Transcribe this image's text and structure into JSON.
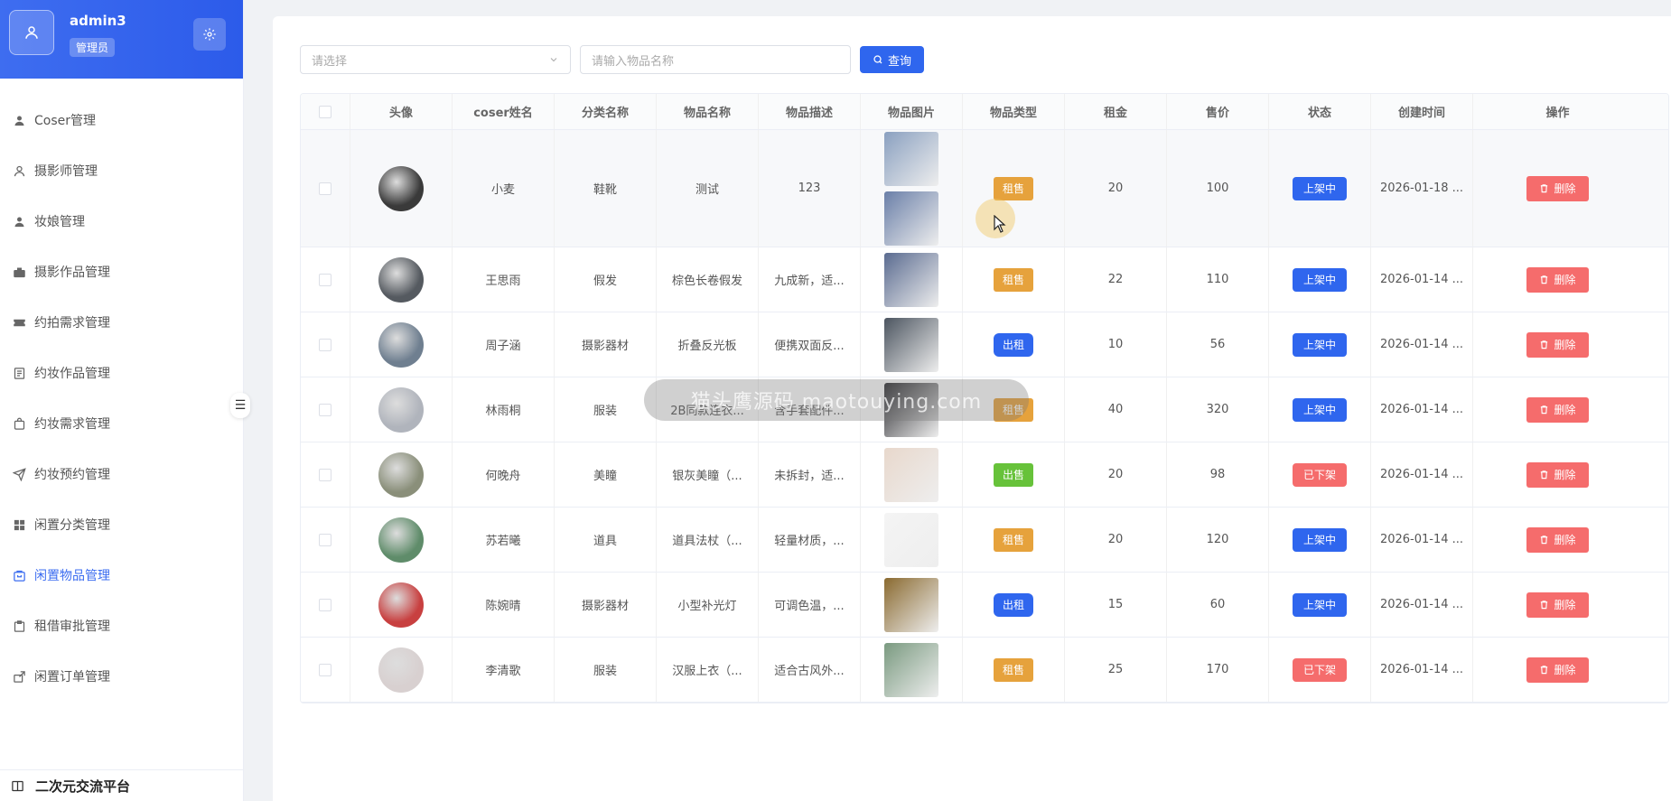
{
  "user": {
    "name": "admin3",
    "role": "管理员"
  },
  "menu": [
    {
      "label": "Coser管理",
      "icon": "user-icon",
      "active": false
    },
    {
      "label": "摄影师管理",
      "icon": "user-outline-icon",
      "active": false
    },
    {
      "label": "妆娘管理",
      "icon": "user-icon",
      "active": false
    },
    {
      "label": "摄影作品管理",
      "icon": "camera-icon",
      "active": false
    },
    {
      "label": "约拍需求管理",
      "icon": "ticket-icon",
      "active": false
    },
    {
      "label": "约妆作品管理",
      "icon": "document-icon",
      "active": false
    },
    {
      "label": "约妆需求管理",
      "icon": "bag-icon",
      "active": false
    },
    {
      "label": "约妆预约管理",
      "icon": "send-icon",
      "active": false
    },
    {
      "label": "闲置分类管理",
      "icon": "grid-icon",
      "active": false
    },
    {
      "label": "闲置物品管理",
      "icon": "box-icon",
      "active": true
    },
    {
      "label": "租借审批管理",
      "icon": "clipboard-icon",
      "active": false
    },
    {
      "label": "闲置订单管理",
      "icon": "share-icon",
      "active": false
    }
  ],
  "footer": {
    "title": "二次元交流平台"
  },
  "filters": {
    "select_placeholder": "请选择",
    "input_placeholder": "请输入物品名称",
    "query_label": "查询"
  },
  "table": {
    "headers": [
      "",
      "头像",
      "coser姓名",
      "分类名称",
      "物品名称",
      "物品描述",
      "物品图片",
      "物品类型",
      "租金",
      "售价",
      "状态",
      "创建时间",
      "操作"
    ],
    "delete_label": "删除",
    "rows": [
      {
        "avatar_color": "#3a3a3a",
        "name": "小麦",
        "category": "鞋靴",
        "item": "测试",
        "desc": "123",
        "images": [
          "#8aa0c0",
          "#6a7fa8"
        ],
        "type": "租售",
        "type_kind": "rent-sale",
        "rent": "20",
        "price": "100",
        "status": "上架中",
        "status_kind": "on",
        "time": "2026-01-18 ..."
      },
      {
        "avatar_color": "#555a60",
        "name": "王思雨",
        "category": "假发",
        "item": "棕色长卷假发",
        "desc": "九成新，适...",
        "images": [
          "#5a6b90"
        ],
        "type": "租售",
        "type_kind": "rent-sale",
        "rent": "22",
        "price": "110",
        "status": "上架中",
        "status_kind": "on",
        "time": "2026-01-14 ..."
      },
      {
        "avatar_color": "#6f7f90",
        "name": "周子涵",
        "category": "摄影器材",
        "item": "折叠反光板",
        "desc": "便携双面反...",
        "images": [
          "#4c5560"
        ],
        "type": "出租",
        "type_kind": "rent",
        "rent": "10",
        "price": "56",
        "status": "上架中",
        "status_kind": "on",
        "time": "2026-01-14 ..."
      },
      {
        "avatar_color": "#b0b4bc",
        "name": "林雨桐",
        "category": "服装",
        "item": "2B同款连衣...",
        "desc": "含手套配件...",
        "images": [
          "#2a2a2e"
        ],
        "type": "租售",
        "type_kind": "rent-sale",
        "rent": "40",
        "price": "320",
        "status": "上架中",
        "status_kind": "on",
        "time": "2026-01-14 ..."
      },
      {
        "avatar_color": "#8a8f7a",
        "name": "何晚舟",
        "category": "美瞳",
        "item": "银灰美瞳（...",
        "desc": "未拆封，适...",
        "images": [
          "#e8d8cc"
        ],
        "type": "出售",
        "type_kind": "sell",
        "rent": "20",
        "price": "98",
        "status": "已下架",
        "status_kind": "off",
        "time": "2026-01-14 ..."
      },
      {
        "avatar_color": "#5f8c6a",
        "name": "苏若曦",
        "category": "道具",
        "item": "道具法杖（...",
        "desc": "轻量材质，...",
        "images": [
          "#f4f4f4"
        ],
        "type": "租售",
        "type_kind": "rent-sale",
        "rent": "20",
        "price": "120",
        "status": "上架中",
        "status_kind": "on",
        "time": "2026-01-14 ..."
      },
      {
        "avatar_color": "#c84040",
        "name": "陈婉晴",
        "category": "摄影器材",
        "item": "小型补光灯",
        "desc": "可调色温，...",
        "images": [
          "#8a6a30"
        ],
        "type": "出租",
        "type_kind": "rent",
        "rent": "15",
        "price": "60",
        "status": "上架中",
        "status_kind": "on",
        "time": "2026-01-14 ..."
      },
      {
        "avatar_color": "#d8d0d0",
        "name": "李清歌",
        "category": "服装",
        "item": "汉服上衣（...",
        "desc": "适合古风外...",
        "images": [
          "#7a9a80"
        ],
        "type": "租售",
        "type_kind": "rent-sale",
        "rent": "25",
        "price": "170",
        "status": "已下架",
        "status_kind": "off",
        "time": "2026-01-14 ..."
      }
    ]
  },
  "watermark": "猫头鹰源码 maotouying.com"
}
